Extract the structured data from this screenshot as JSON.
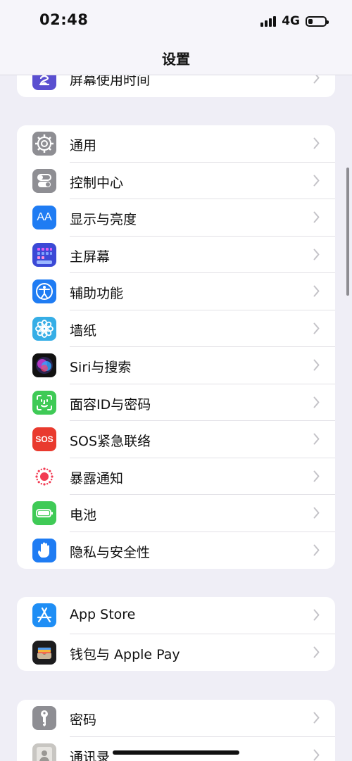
{
  "status": {
    "time": "02:48",
    "network": "4G",
    "battery_level": 0.25
  },
  "nav": {
    "title": "设置"
  },
  "groups": [
    {
      "items": [
        {
          "label": "屏幕使用时间",
          "icon": "hourglass-icon",
          "color": "#5a4fd0"
        }
      ]
    },
    {
      "items": [
        {
          "label": "通用",
          "icon": "gear-icon",
          "color": "#8e8e93"
        },
        {
          "label": "控制中心",
          "icon": "toggles-icon",
          "color": "#8e8e93"
        },
        {
          "label": "显示与亮度",
          "icon": "text-size-icon",
          "icon_text": "AA",
          "color": "#1f7cf3"
        },
        {
          "label": "主屏幕",
          "icon": "home-grid-icon",
          "color": "#3b49d6"
        },
        {
          "label": "辅助功能",
          "icon": "accessibility-icon",
          "color": "#1f7cf3"
        },
        {
          "label": "墙纸",
          "icon": "flower-icon",
          "color": "#36aee6"
        },
        {
          "label": "Siri与搜索",
          "icon": "siri-icon",
          "color": "#1b1b2e"
        },
        {
          "label": "面容ID与密码",
          "icon": "face-id-icon",
          "color": "#3fca56"
        },
        {
          "label": "SOS紧急联络",
          "icon": "sos-icon",
          "icon_text": "SOS",
          "color": "#e93a2e"
        },
        {
          "label": "暴露通知",
          "icon": "exposure-icon",
          "color": "#ffffff"
        },
        {
          "label": "电池",
          "icon": "battery-icon",
          "color": "#3fca56"
        },
        {
          "label": "隐私与安全性",
          "icon": "hand-icon",
          "color": "#1f7cf3"
        }
      ]
    },
    {
      "items": [
        {
          "label": "App Store",
          "icon": "app-store-icon",
          "color": "#1f8ef5"
        },
        {
          "label": "钱包与 Apple Pay",
          "icon": "wallet-icon",
          "color": "#1c1c1e"
        }
      ]
    },
    {
      "items": [
        {
          "label": "密码",
          "icon": "key-icon",
          "color": "#8e8e93"
        },
        {
          "label": "通讯录",
          "icon": "contacts-icon",
          "color": "#c8c6c2"
        }
      ]
    }
  ]
}
